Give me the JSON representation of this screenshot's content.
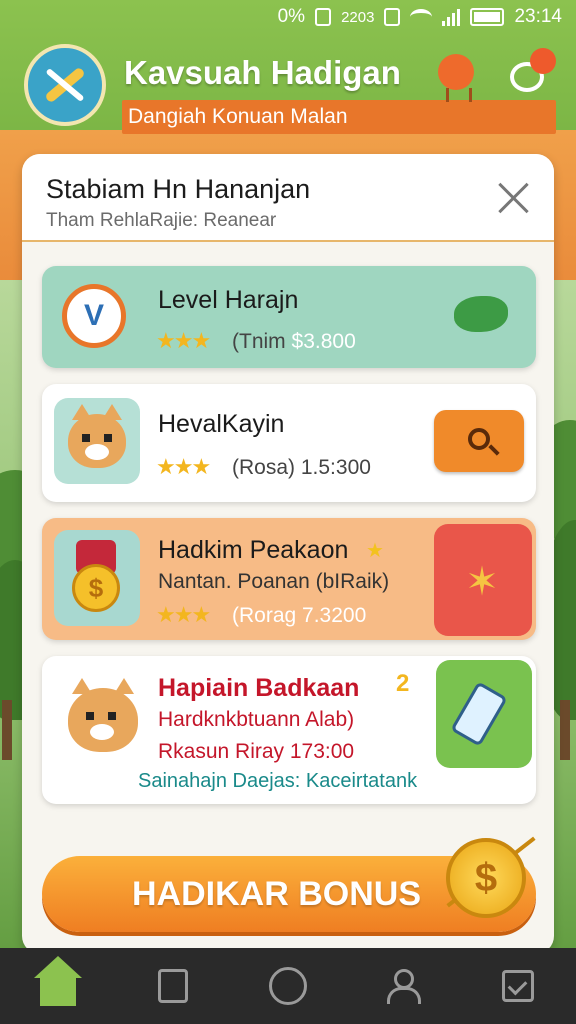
{
  "status_bar": {
    "battery_text": "0%",
    "time": "23:14",
    "indicator_text": "2203"
  },
  "header": {
    "title": "Kavsuah Hadigan",
    "subtitle": "Dangiah Konuan Malan"
  },
  "panel": {
    "title": "Stabiam Hn Hananjan",
    "subtitle": "Tham RehlaRajie: Reanear"
  },
  "items": [
    {
      "title": "Level Harajn",
      "stars": "★★★",
      "meta_prefix": "(Tnim",
      "meta_value": "$3.800"
    },
    {
      "title": "HevalKayin",
      "stars": "★★★",
      "meta_prefix": "(Rosa)",
      "meta_value": "1.5:300"
    },
    {
      "title": "Hadkim Peakaon",
      "subtitle": "Nantan. Poanan (bIRaik)",
      "stars": "★★★",
      "meta_prefix": "(Rorag",
      "meta_value": "7.3200"
    },
    {
      "title": "Hapiain Badkaan",
      "subtitle": "Hardknkbtuann Alab)",
      "meta": "Rkasun Riray 173:00",
      "note": "Sainahajn Daejas: Kaceirtatank",
      "badge_number": "2"
    }
  ],
  "bonus_button": {
    "label": "HADIKAR BONUS"
  },
  "colors": {
    "accent_orange": "#ef7e22",
    "accent_green": "#8cc24f",
    "card_teal": "#9fd6c0",
    "card_peach": "#f7bb86",
    "title_red": "#c4162a",
    "note_teal": "#1a8a8a"
  },
  "icons": {
    "header": [
      "app-logo-icon",
      "trophy-icon",
      "chat-icon"
    ],
    "nav": [
      "home-icon",
      "book-icon",
      "circle-icon",
      "profile-icon",
      "checklist-icon"
    ]
  }
}
